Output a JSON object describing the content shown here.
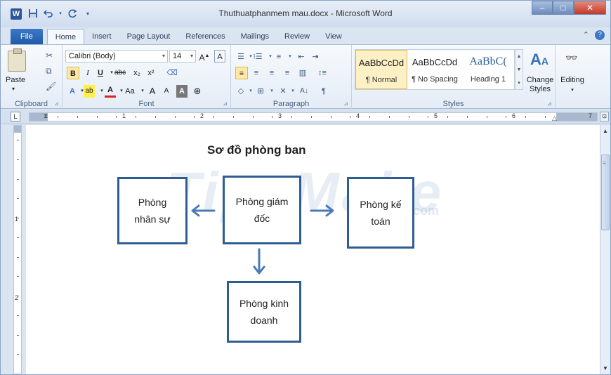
{
  "window": {
    "title": "Thuthuatphanmem mau.docx - Microsoft Word",
    "app_icon": "W",
    "controls": {
      "minimize": "‒",
      "maximize": "□",
      "close": "✕"
    }
  },
  "quick_access": {
    "save": "💾",
    "undo": "↶",
    "redo": "↻",
    "customize": "▾"
  },
  "tabs": [
    "File",
    "Home",
    "Insert",
    "Page Layout",
    "References",
    "Mailings",
    "Review",
    "View"
  ],
  "active_tab": "Home",
  "ribbon": {
    "clipboard": {
      "label": "Clipboard",
      "paste": "Paste",
      "launcher": "⊿"
    },
    "font": {
      "label": "Font",
      "font_name": "Calibri (Body)",
      "font_size": "14",
      "bold": "B",
      "italic": "I",
      "underline": "U",
      "strikethrough": "abc",
      "subscript": "x₂",
      "superscript": "x²",
      "grow": "A",
      "shrink": "A",
      "change_case": "Aa",
      "text_effects": "A",
      "highlight": "ab",
      "font_color": "A",
      "clear_formatting": "A",
      "launcher": "⊿"
    },
    "paragraph": {
      "label": "Paragraph",
      "bullets": "☰",
      "numbering": "⁝☰",
      "multilevel": "≡",
      "decrease_indent": "⇤",
      "increase_indent": "⇥",
      "align_left": "≡",
      "align_center": "≡",
      "align_right": "≡",
      "justify": "≡",
      "columns": "▥",
      "line_spacing": "↕≡",
      "shading": "◇",
      "borders": "⊞",
      "show_marks": "¶",
      "sort": "A↓",
      "launcher": "⊿"
    },
    "styles": {
      "label": "Styles",
      "items": [
        {
          "sample": "AaBbCcDd",
          "name": "¶ Normal"
        },
        {
          "sample": "AaBbCcDd",
          "name": "¶ No Spacing"
        },
        {
          "sample": "AaBbC(",
          "name": "Heading 1"
        }
      ],
      "change_styles": "Change Styles",
      "launcher": "⊿"
    },
    "editing": {
      "label": "Editing"
    }
  },
  "ruler": {
    "numbers": [
      "1",
      "2",
      "3",
      "4",
      "5",
      "6",
      "7"
    ],
    "vertical_numbers": [
      "1",
      "2"
    ]
  },
  "document": {
    "title": "Sơ đồ phòng ban",
    "watermark": "TipsMake",
    "watermark_suffix": ".com",
    "boxes": {
      "director": [
        "Phòng giám",
        "đốc"
      ],
      "hr": [
        "Phòng",
        "nhân sự"
      ],
      "accounting": [
        "Phòng kế",
        "toán"
      ],
      "business": [
        "Phòng kinh",
        "doanh"
      ]
    },
    "colors": {
      "box_border": "#2f5d93",
      "arrow": "#4a7ab8"
    }
  }
}
